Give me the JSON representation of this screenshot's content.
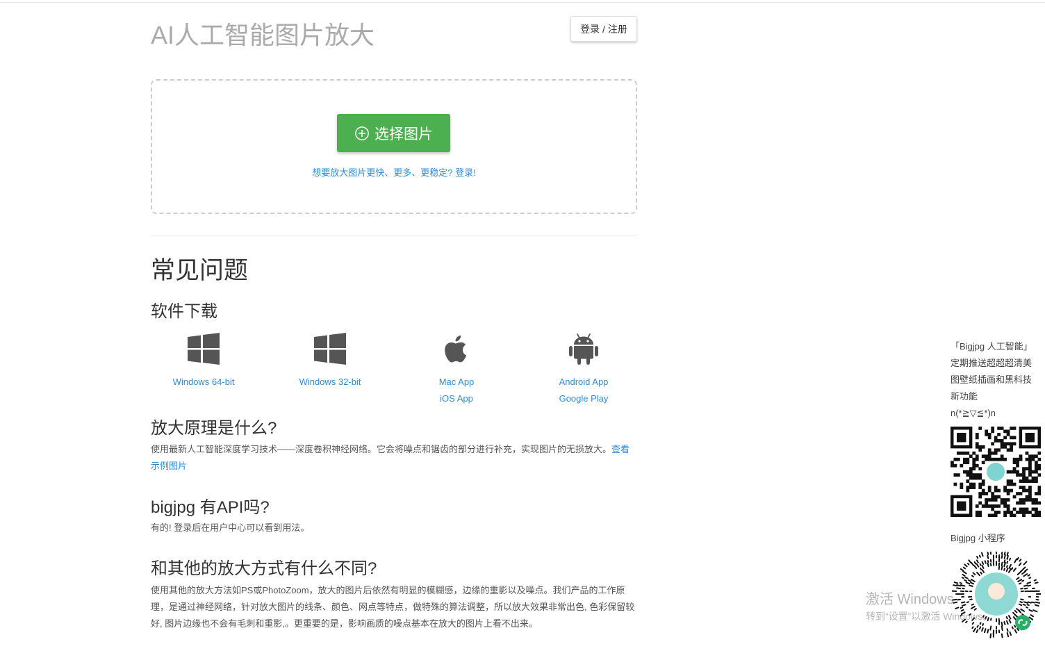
{
  "header": {
    "title": "AI人工智能图片放大",
    "login_label": "登录 / 注册"
  },
  "upload": {
    "select_label": "选择图片",
    "speed_link": "想要放大图片更快、更多、更稳定? 登录!"
  },
  "faq": {
    "title": "常见问题",
    "download_title": "软件下载",
    "downloads": [
      {
        "icon": "windows-icon",
        "links": [
          "Windows 64-bit"
        ]
      },
      {
        "icon": "windows-icon",
        "links": [
          "Windows 32-bit"
        ]
      },
      {
        "icon": "apple-icon",
        "links": [
          "Mac App",
          "iOS App"
        ]
      },
      {
        "icon": "android-icon",
        "links": [
          "Android App",
          "Google Play"
        ]
      }
    ],
    "q1": "放大原理是什么?",
    "a1_text": "使用最新人工智能深度学习技术——深度卷积神经网络。它会将噪点和锯齿的部分进行补充，实现图片的无损放大。",
    "a1_link": "查看示例图片",
    "q2": "bigjpg 有API吗?",
    "a2": "有的! 登录后在用户中心可以看到用法。",
    "q3": "和其他的放大方式有什么不同?",
    "a3": "使用其他的放大方法如PS或PhotoZoom，放大的图片后依然有明显的模糊感，边缘的重影以及噪点。我们产品的工作原理，是通过神经网络，针对放大图片的线条、颜色、网点等特点，做特殊的算法调整，所以放大效果非常出色, 色彩保留较好, 图片边缘也不会有毛刺和重影,。更重要的是，影响画质的噪点基本在放大的图片上看不出来。"
  },
  "side": {
    "promo_lines": [
      "「Bigjpg 人工智能」",
      "定期推送超超超清美",
      "图壁纸插画和黑科技",
      "新功能",
      "n(*≧▽≦*)n"
    ],
    "mini_label": "Bigjpg 小程序"
  },
  "watermark": {
    "line1": "激活 Windows",
    "line2": "转到“设置”以激活 Windows。"
  },
  "colors": {
    "accent_green": "#4caf50",
    "link_blue": "#2f8bd6",
    "title_gray": "#aaaaaa"
  }
}
